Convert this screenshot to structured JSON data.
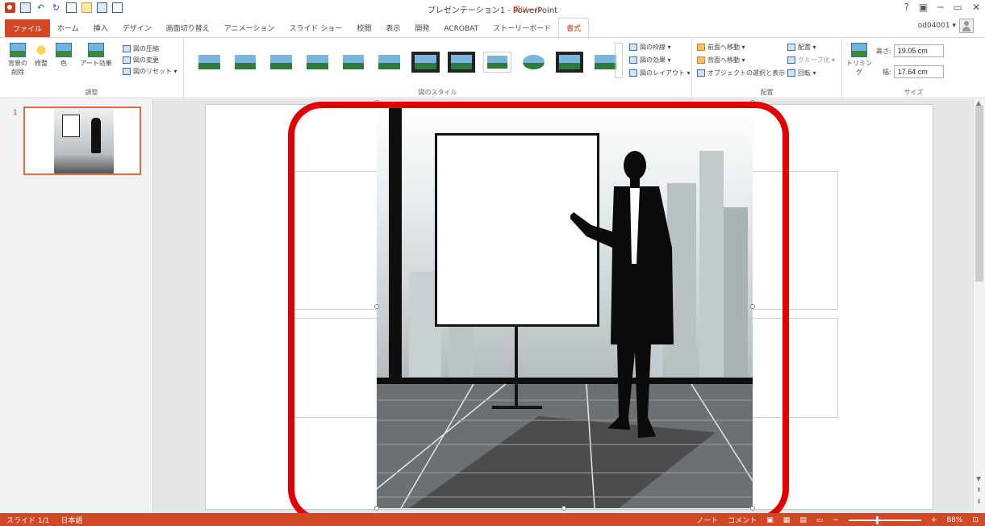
{
  "window": {
    "title": "プレゼンテーション1 - PowerPoint",
    "context_tab_group": "図ツール",
    "controls": [
      "?",
      "▣",
      "─",
      "▭",
      "✕"
    ]
  },
  "quick_access": {
    "undo": "↶",
    "redo": "↻"
  },
  "tabs": [
    {
      "label": "ファイル",
      "kind": "file"
    },
    {
      "label": "ホーム"
    },
    {
      "label": "挿入"
    },
    {
      "label": "デザイン"
    },
    {
      "label": "画面切り替え"
    },
    {
      "label": "アニメーション"
    },
    {
      "label": "スライド ショー"
    },
    {
      "label": "校閲"
    },
    {
      "label": "表示"
    },
    {
      "label": "開発"
    },
    {
      "label": "ACROBAT"
    },
    {
      "label": "ストーリーボード"
    },
    {
      "label": "書式",
      "kind": "active"
    }
  ],
  "user": {
    "name": "od04001 ▾"
  },
  "ribbon": {
    "adjust": {
      "label": "調整",
      "remove_background": "背景の\n削除",
      "corrections": "修整",
      "color": "色",
      "artistic_effects": "アート効果",
      "compress": "図の圧縮",
      "change_picture": "図の変更",
      "reset_picture": "図のリセット ▾"
    },
    "picture_styles": {
      "label": "図のスタイル",
      "border": "図の枠線 ▾",
      "effects": "図の効果 ▾",
      "layout": "図のレイアウト ▾",
      "thumbs": [
        "plain",
        "plain",
        "plain",
        "plain",
        "plain",
        "plain",
        "frame",
        "frame",
        "white",
        "oval",
        "frame",
        "plain"
      ]
    },
    "arrange": {
      "label": "配置",
      "bring_forward": "前面へ移動 ▾",
      "send_backward": "背面へ移動 ▾",
      "selection_pane": "オブジェクトの選択と表示",
      "align": "配置 ▾",
      "group": "グループ化 ▾",
      "rotate": "回転 ▾"
    },
    "size": {
      "label": "サイズ",
      "crop": "トリミング",
      "height_label": "高さ:",
      "height_value": "19.05 cm",
      "width_label": "幅:",
      "width_value": "17.64 cm"
    }
  },
  "slides_pane": {
    "slide_number": "1"
  },
  "statusbar": {
    "slide_info": "スライド 1/1",
    "language": "日本語",
    "notes": "ノート",
    "comments": "コメント",
    "zoom": "88%",
    "zoom_level": 0.88
  },
  "colors": {
    "accent": "#D24726",
    "highlight": "#E00000"
  }
}
